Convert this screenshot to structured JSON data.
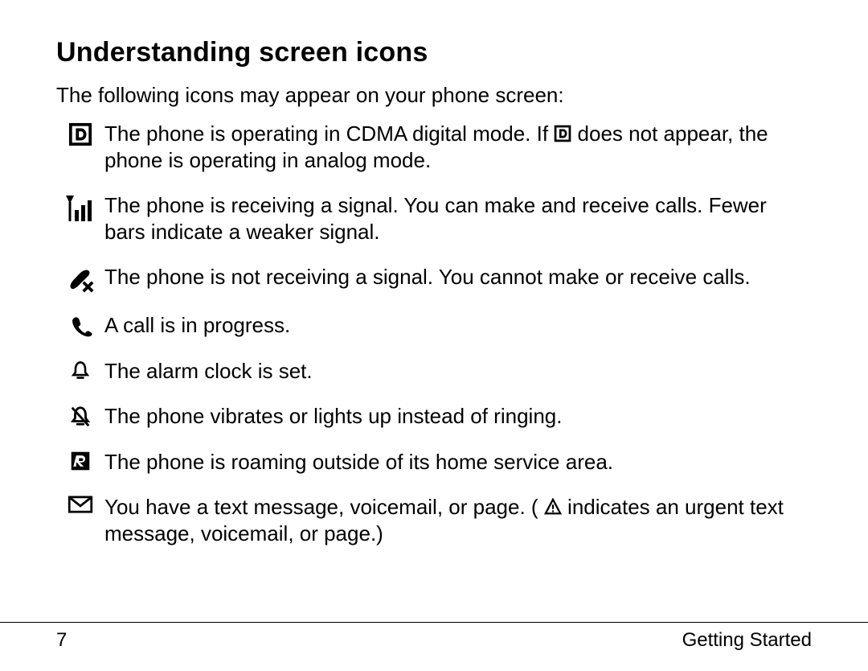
{
  "title": "Understanding screen icons",
  "intro": "The following icons may appear on your phone screen:",
  "items": [
    {
      "icon": "digital-mode",
      "text_before": "The phone is operating in CDMA digital mode. If ",
      "inline_icon": "digital-mode-small",
      "text_after": " does not appear, the phone is operating in analog mode."
    },
    {
      "icon": "signal",
      "text": "The phone is receiving a signal. You can make and receive calls. Fewer bars indicate a weaker signal."
    },
    {
      "icon": "no-signal",
      "text": "The phone is not receiving a signal. You cannot make or receive calls."
    },
    {
      "icon": "call-in-progress",
      "text": "A call is in progress."
    },
    {
      "icon": "alarm",
      "text": "The alarm clock is set."
    },
    {
      "icon": "vibrate",
      "text": "The phone vibrates or lights up instead of ringing."
    },
    {
      "icon": "roaming",
      "text": "The phone is roaming outside of its home service area."
    },
    {
      "icon": "message",
      "text_before": "You have a text message, voicemail, or page. (",
      "inline_icon": "urgent",
      "text_after": "indicates an urgent text message, voicemail, or page.)"
    }
  ],
  "footer": {
    "page_number": "7",
    "section": "Getting Started"
  }
}
